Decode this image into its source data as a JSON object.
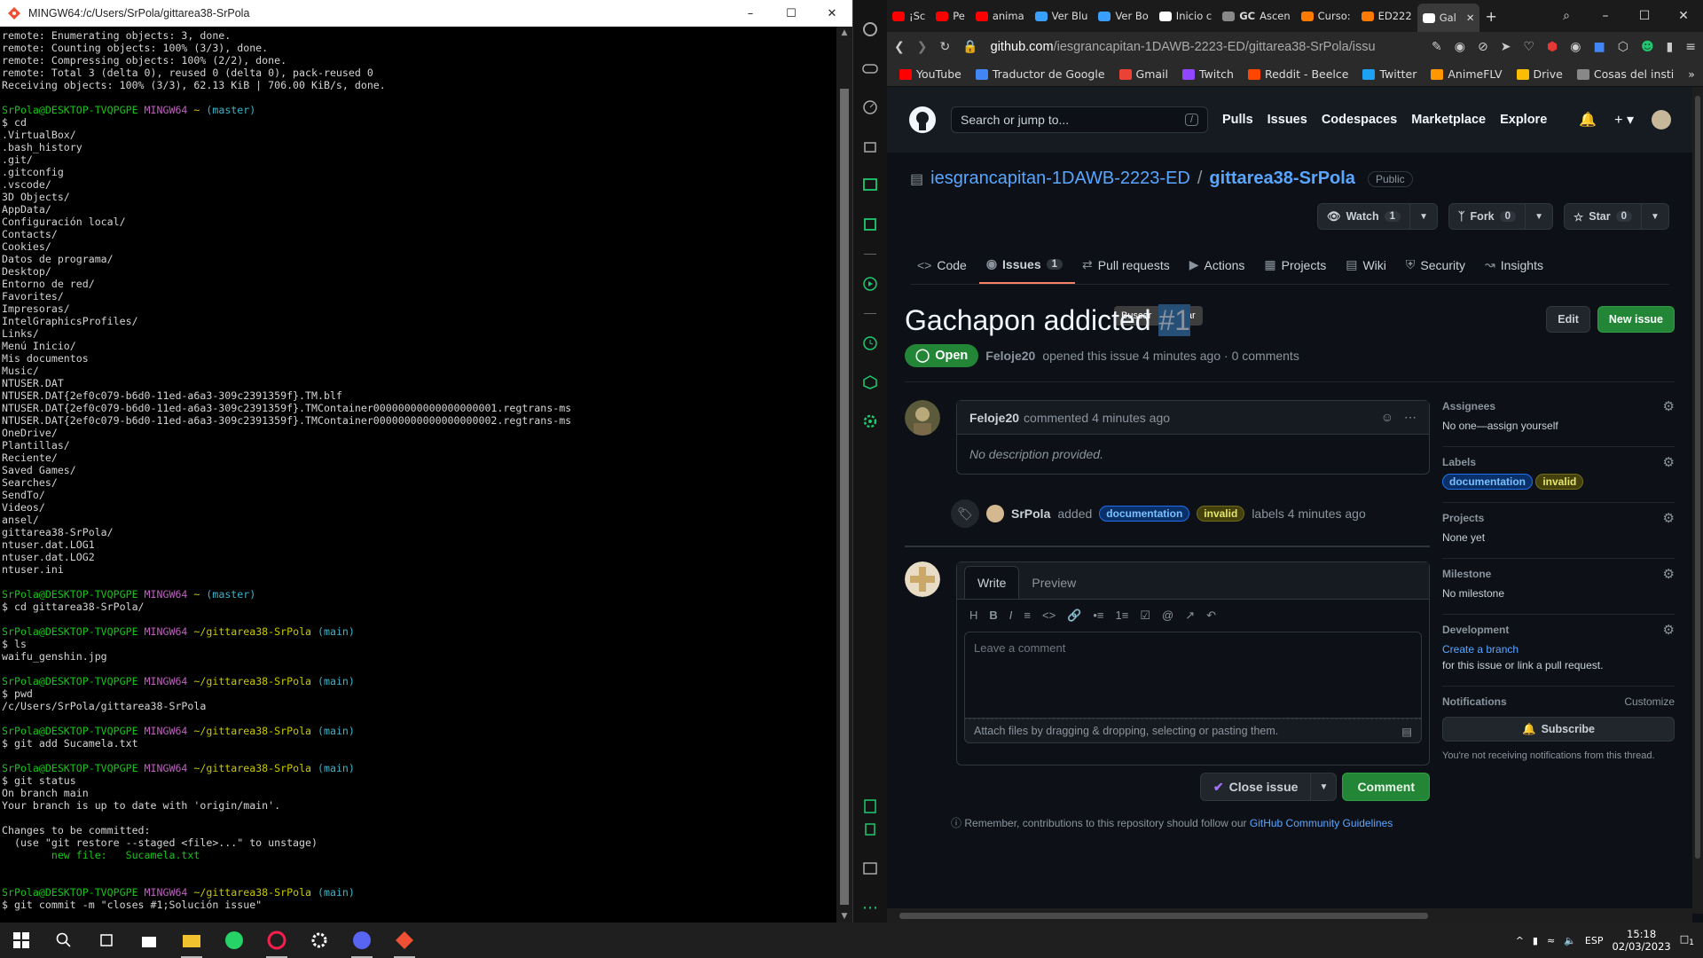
{
  "terminal": {
    "title": "MINGW64:/c/Users/SrPola/gittarea38-SrPola",
    "lines": [
      {
        "t": "remote: Enumerating objects: 3, done."
      },
      {
        "t": "remote: Counting objects: 100% (3/3), done."
      },
      {
        "t": "remote: Compressing objects: 100% (2/2), done."
      },
      {
        "t": "remote: Total 3 (delta 0), reused 0 (delta 0), pack-reused 0"
      },
      {
        "t": "Receiving objects: 100% (3/3), 62.13 KiB | 706.00 KiB/s, done."
      },
      {
        "t": ""
      },
      {
        "prompt": true,
        "user": "SrPola@DESKTOP-TVQPGPE",
        "sys": "MINGW64",
        "path": "~",
        "branch": "(master)"
      },
      {
        "t": "$ cd"
      },
      {
        "t": ".VirtualBox/"
      },
      {
        "t": ".bash_history"
      },
      {
        "t": ".git/"
      },
      {
        "t": ".gitconfig"
      },
      {
        "t": ".vscode/"
      },
      {
        "t": "3D Objects/"
      },
      {
        "t": "AppData/"
      },
      {
        "t": "Configuración local/"
      },
      {
        "t": "Contacts/"
      },
      {
        "t": "Cookies/"
      },
      {
        "t": "Datos de programa/"
      },
      {
        "t": "Desktop/"
      },
      {
        "t": "Entorno de red/"
      },
      {
        "t": "Favorites/"
      },
      {
        "t": "Impresoras/"
      },
      {
        "t": "IntelGraphicsProfiles/"
      },
      {
        "t": "Links/"
      },
      {
        "t": "Menú Inicio/"
      },
      {
        "t": "Mis documentos"
      },
      {
        "t": "Music/"
      },
      {
        "t": "NTUSER.DAT"
      },
      {
        "t": "NTUSER.DAT{2ef0c079-b6d0-11ed-a6a3-309c2391359f}.TM.blf"
      },
      {
        "t": "NTUSER.DAT{2ef0c079-b6d0-11ed-a6a3-309c2391359f}.TMContainer00000000000000000001.regtrans-ms"
      },
      {
        "t": "NTUSER.DAT{2ef0c079-b6d0-11ed-a6a3-309c2391359f}.TMContainer00000000000000000002.regtrans-ms"
      },
      {
        "t": "OneDrive/"
      },
      {
        "t": "Plantillas/"
      },
      {
        "t": "Reciente/"
      },
      {
        "t": "Saved Games/"
      },
      {
        "t": "Searches/"
      },
      {
        "t": "SendTo/"
      },
      {
        "t": "Videos/"
      },
      {
        "t": "ansel/"
      },
      {
        "t": "gittarea38-SrPola/"
      },
      {
        "t": "ntuser.dat.LOG1"
      },
      {
        "t": "ntuser.dat.LOG2"
      },
      {
        "t": "ntuser.ini"
      },
      {
        "t": ""
      },
      {
        "prompt": true,
        "user": "SrPola@DESKTOP-TVQPGPE",
        "sys": "MINGW64",
        "path": "~",
        "branch": "(master)"
      },
      {
        "t": "$ cd gittarea38-SrPola/"
      },
      {
        "t": ""
      },
      {
        "prompt": true,
        "user": "SrPola@DESKTOP-TVQPGPE",
        "sys": "MINGW64",
        "path": "~/gittarea38-SrPola",
        "branch": "(main)"
      },
      {
        "t": "$ ls"
      },
      {
        "t": "waifu_genshin.jpg"
      },
      {
        "t": ""
      },
      {
        "prompt": true,
        "user": "SrPola@DESKTOP-TVQPGPE",
        "sys": "MINGW64",
        "path": "~/gittarea38-SrPola",
        "branch": "(main)"
      },
      {
        "t": "$ pwd"
      },
      {
        "t": "/c/Users/SrPola/gittarea38-SrPola"
      },
      {
        "t": ""
      },
      {
        "prompt": true,
        "user": "SrPola@DESKTOP-TVQPGPE",
        "sys": "MINGW64",
        "path": "~/gittarea38-SrPola",
        "branch": "(main)"
      },
      {
        "t": "$ git add Sucamela.txt"
      },
      {
        "t": ""
      },
      {
        "prompt": true,
        "user": "SrPola@DESKTOP-TVQPGPE",
        "sys": "MINGW64",
        "path": "~/gittarea38-SrPola",
        "branch": "(main)"
      },
      {
        "t": "$ git status"
      },
      {
        "t": "On branch main"
      },
      {
        "t": "Your branch is up to date with 'origin/main'."
      },
      {
        "t": ""
      },
      {
        "t": "Changes to be committed:"
      },
      {
        "t": "  (use \"git restore --staged <file>...\" to unstage)"
      },
      {
        "t": "        new file:   Sucamela.txt",
        "green": true
      },
      {
        "t": ""
      },
      {
        "t": ""
      },
      {
        "prompt": true,
        "user": "SrPola@DESKTOP-TVQPGPE",
        "sys": "MINGW64",
        "path": "~/gittarea38-SrPola",
        "branch": "(main)"
      },
      {
        "t": "$ git commit -m \"closes #1;Solución issue\""
      }
    ]
  },
  "browser": {
    "tabs": [
      {
        "label": "¡Sc",
        "color": "#ff0000"
      },
      {
        "label": "Pe",
        "color": "#ff0000"
      },
      {
        "label": "anima",
        "color": "#ff0000"
      },
      {
        "label": "Ver Blu",
        "color": "#3aa0ff"
      },
      {
        "label": "Ver Bo",
        "color": "#3aa0ff"
      },
      {
        "label": "Inicio c",
        "color": "#ffffff"
      },
      {
        "label": "Ascen",
        "color": "#888888",
        "prefix": "GC"
      },
      {
        "label": "Curso:",
        "color": "#ff7a00"
      },
      {
        "label": "ED222",
        "color": "#ff7a00"
      },
      {
        "label": "Gal",
        "color": "#ffffff",
        "active": true
      }
    ],
    "url_domain": "github.com",
    "url_path": "/iesgrancapitan-1DAWB-2223-ED/gittarea38-SrPola/issu",
    "bookmarks": [
      {
        "label": "YouTube",
        "color": "#ff0000"
      },
      {
        "label": "Traductor de Google",
        "color": "#4285f4"
      },
      {
        "label": "Gmail",
        "color": "#ea4335"
      },
      {
        "label": "Twitch",
        "color": "#9146ff"
      },
      {
        "label": "Reddit - Beelce",
        "color": "#ff4500"
      },
      {
        "label": "Twitter",
        "color": "#1da1f2"
      },
      {
        "label": "AnimeFLV",
        "color": "#ff9800"
      },
      {
        "label": "Drive",
        "color": "#fbbc04"
      },
      {
        "label": "Cosas del insti",
        "color": "#888888"
      }
    ]
  },
  "github": {
    "search_placeholder": "Search or jump to...",
    "search_key": "/",
    "nav": [
      "Pulls",
      "Issues",
      "Codespaces",
      "Marketplace",
      "Explore"
    ],
    "org": "iesgrancapitan-1DAWB-2223-ED",
    "repo": "gittarea38-SrPola",
    "visibility": "Public",
    "watch": {
      "label": "Watch",
      "count": "1"
    },
    "fork": {
      "label": "Fork",
      "count": "0"
    },
    "star": {
      "label": "Star",
      "count": "0"
    },
    "tabs": [
      {
        "label": "Code"
      },
      {
        "label": "Issues",
        "count": "1",
        "selected": true
      },
      {
        "label": "Pull requests"
      },
      {
        "label": "Actions"
      },
      {
        "label": "Projects"
      },
      {
        "label": "Wiki"
      },
      {
        "label": "Security"
      },
      {
        "label": "Insights"
      }
    ],
    "tooltip": [
      "Buscar",
      "Copiar"
    ],
    "issue": {
      "title": "Gachapon addicted",
      "number": "#1",
      "edit": "Edit",
      "new_issue": "New issue",
      "state": "Open",
      "author": "Feloje20",
      "meta": "opened this issue 4 minutes ago · 0 comments"
    },
    "comment": {
      "author": "Feloje20",
      "when": "commented 4 minutes ago",
      "body": "No description provided."
    },
    "event": {
      "who": "SrPola",
      "added": "added",
      "labels": [
        "documentation",
        "invalid"
      ],
      "suffix": "labels 4 minutes ago"
    },
    "composer": {
      "write": "Write",
      "preview": "Preview",
      "placeholder": "Leave a comment",
      "attach": "Attach files by dragging & dropping, selecting or pasting them.",
      "close": "Close issue",
      "submit": "Comment"
    },
    "reminder": "Remember, contributions to this repository should follow our",
    "reminder_link": "GitHub Community Guidelines",
    "sidebar": {
      "assignees_title": "Assignees",
      "assignees_value": "No one—assign yourself",
      "labels_title": "Labels",
      "projects_title": "Projects",
      "projects_value": "None yet",
      "milestone_title": "Milestone",
      "milestone_value": "No milestone",
      "development_title": "Development",
      "development_link": "Create a branch",
      "development_note": "for this issue or link a pull request.",
      "notifications_title": "Notifications",
      "customize": "Customize",
      "subscribe": "Subscribe",
      "notify_note": "You're not receiving notifications from this thread."
    }
  },
  "taskbar": {
    "lang": "ESP",
    "time": "15:18",
    "date": "02/03/2023",
    "notif": "1"
  }
}
